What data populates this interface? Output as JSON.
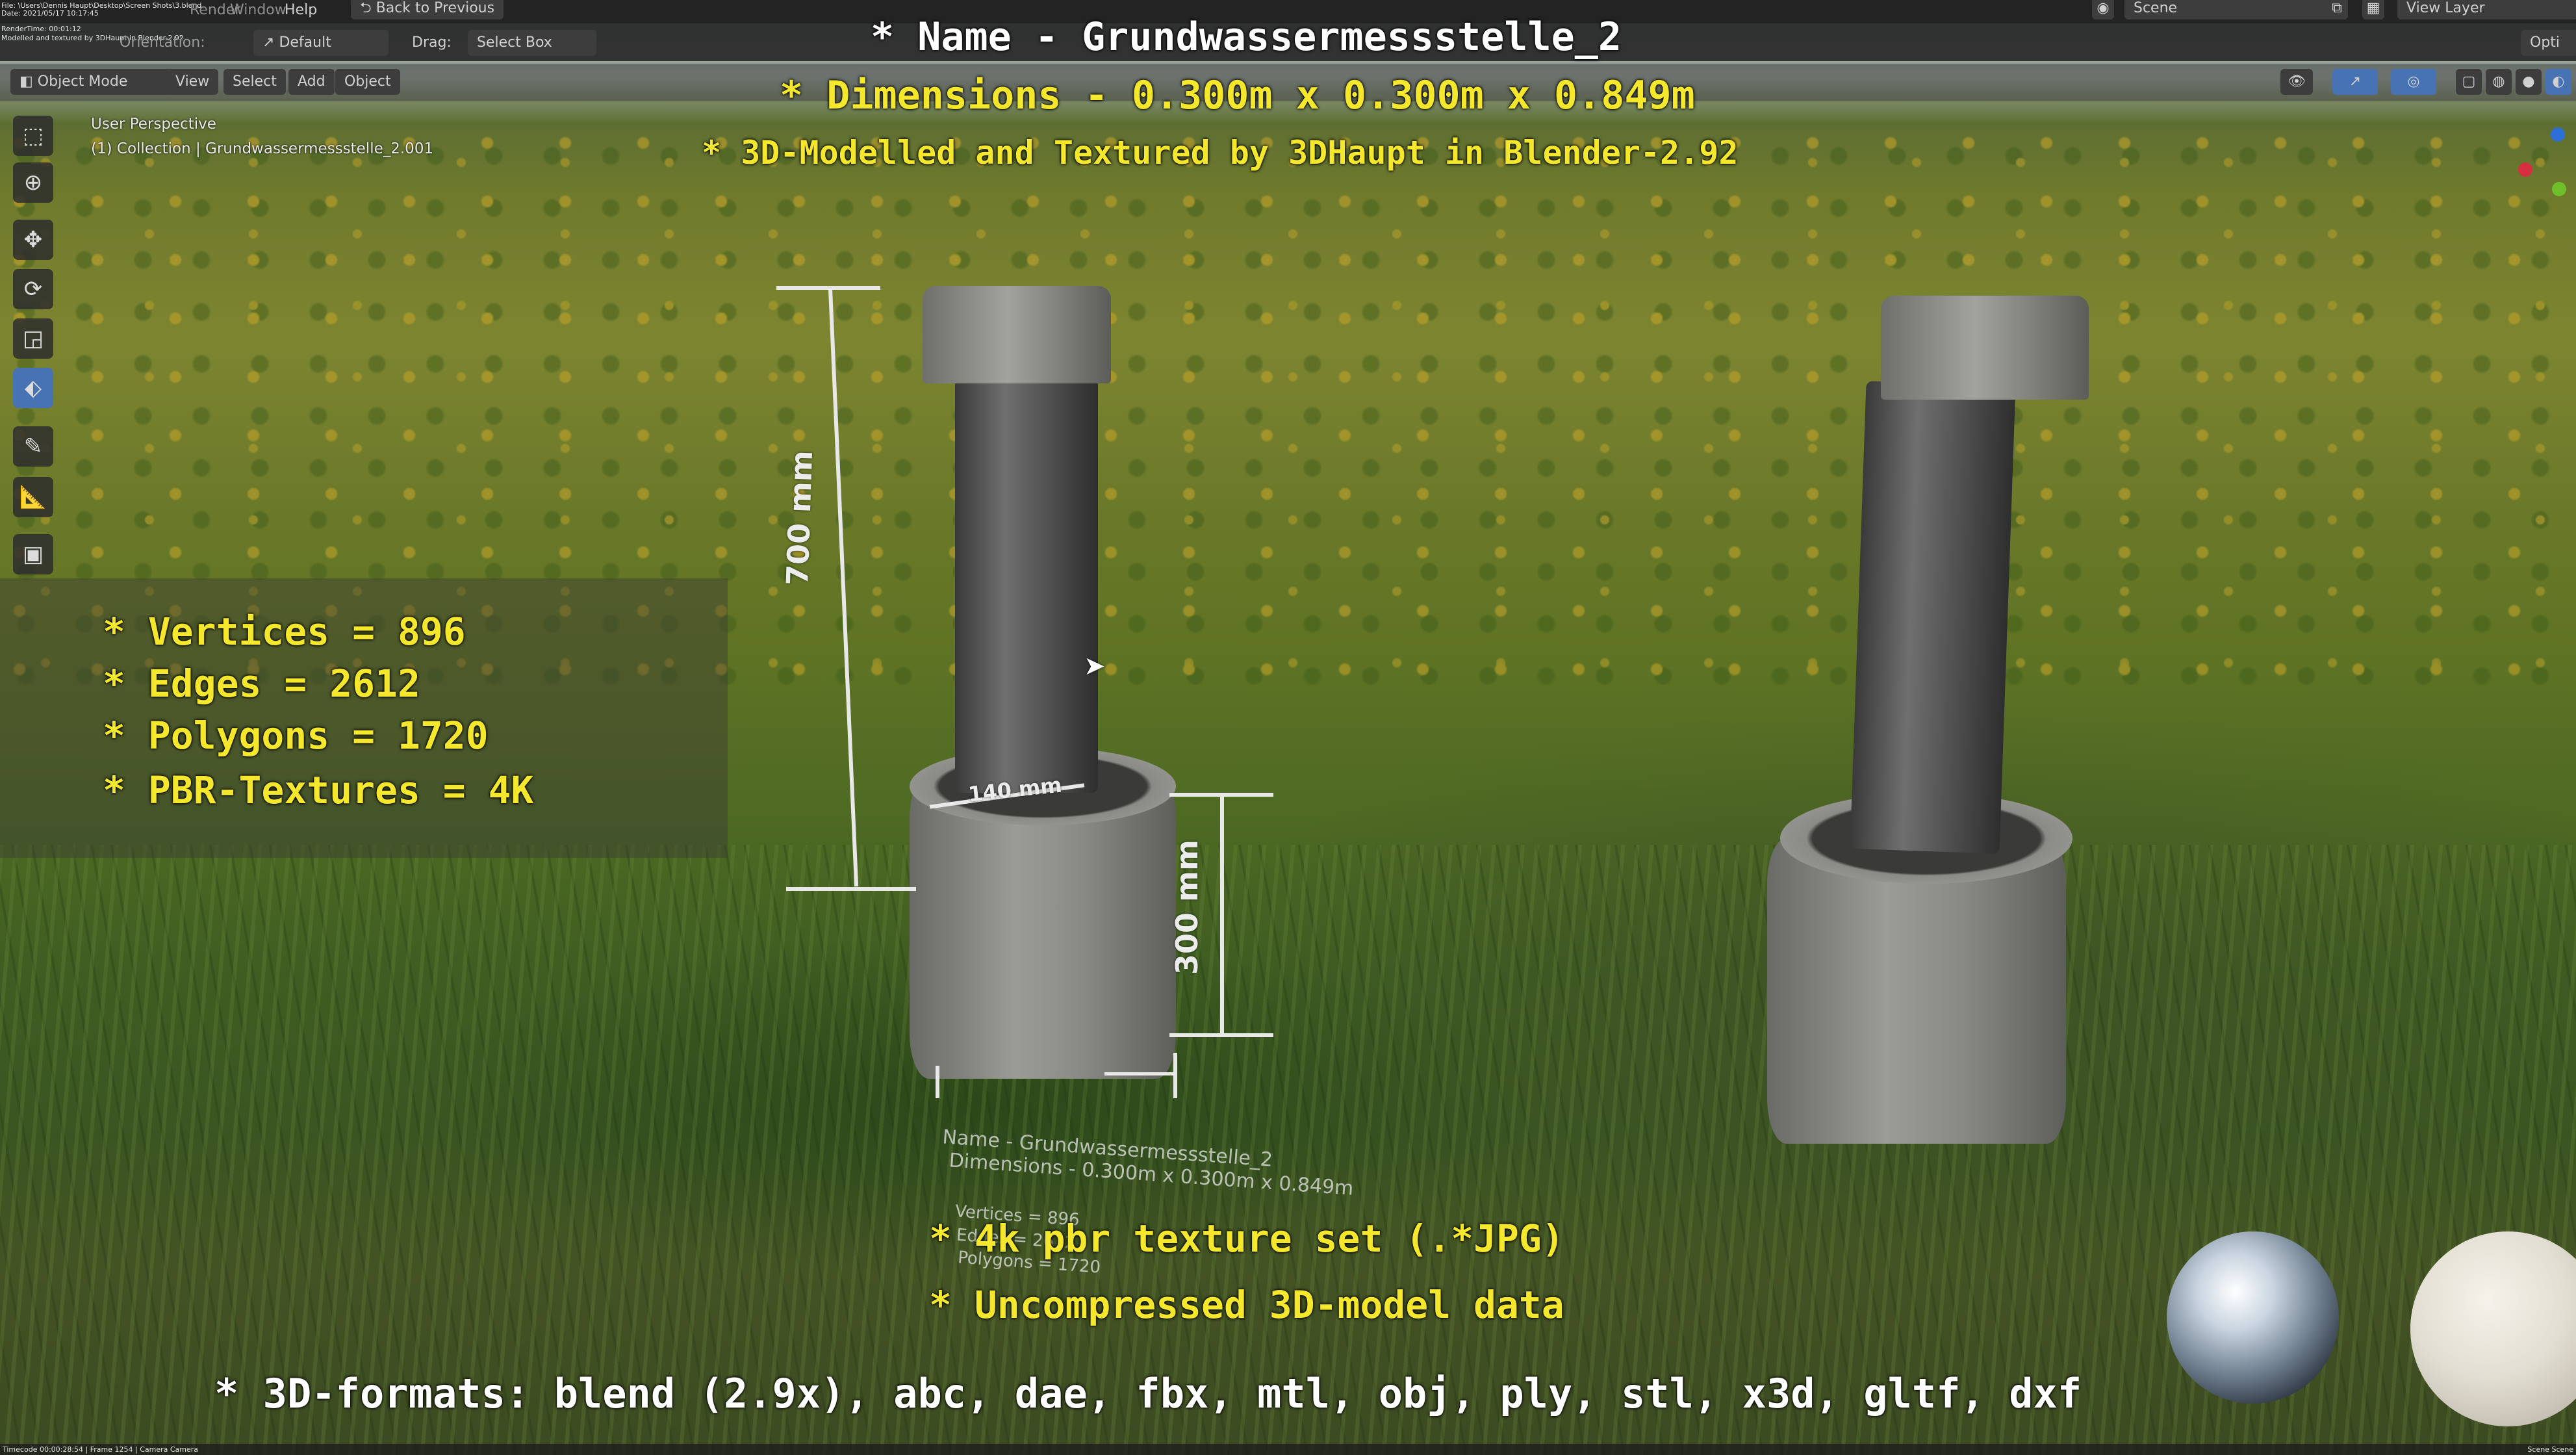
{
  "window": {
    "file_info_lines": [
      "File: \\Users\\Dennis Haupt\\Desktop\\Screen Shots\\3.blend",
      "Date: 2021/05/17 10:17:45",
      "RenderTime: 00:01:12",
      "Modelled and textured by 3DHaupt in Blender-2.92"
    ],
    "menu_render": "Render",
    "menu_window": "Window",
    "menu_help": "Help",
    "back_to_previous": "Back to Previous",
    "scene_label": "Scene",
    "view_layer_label": "View Layer"
  },
  "header": {
    "orientation_label": "Orientation:",
    "orientation_value": "Default",
    "drag_label": "Drag:",
    "drag_value": "Select Box",
    "options_label": "Opti"
  },
  "viewport_header": {
    "mode": "Object Mode",
    "view": "View",
    "select": "Select",
    "add": "Add",
    "object": "Object"
  },
  "viewport": {
    "perspective": "User Perspective",
    "collection": "(1) Collection | Grundwassermessstelle_2.001"
  },
  "toolbar": {
    "tools": [
      "select-box",
      "cursor",
      "move",
      "rotate",
      "scale",
      "transform",
      "annotate",
      "measure",
      "add-cube"
    ]
  },
  "overlay": {
    "name_line": "* Name - Grundwassermessstelle_2",
    "dimensions_line": "* Dimensions -  0.300m x 0.300m x 0.849m",
    "credit_line": "* 3D-Modelled and Textured by 3DHaupt in Blender-2.92",
    "stats": [
      "* Vertices = 896",
      "* Edges = 2612",
      "* Polygons = 1720",
      "* PBR-Textures = 4K"
    ],
    "texture_line": "* 4k pbr texture set (.*JPG)",
    "uncompressed_line": "* Uncompressed 3D-model data",
    "formats_line": "* 3D-formats: blend (2.9x), abc, dae, fbx, mtl, obj, ply, stl, x3d, gltf, dxf"
  },
  "measurements": {
    "height": "700 mm",
    "diameter": "140 mm",
    "base_height": "300 mm"
  },
  "ghost_text": {
    "name": "Name - Grundwassermessstelle_2",
    "dimensions": "Dimensions - 0.300m x 0.300m x 0.849m",
    "vertices": "Vertices = 896",
    "edges": "Edges = 2612",
    "polygons": "Polygons = 1720"
  },
  "status": {
    "timecode": "Timecode 00:00:28:54  |  Frame 1254  |  Camera Camera",
    "right": "Scene Scene"
  },
  "colors": {
    "overlay_white": "#ffffff",
    "overlay_yellow": "#f5e72b",
    "blender_active": "#4772b3"
  }
}
